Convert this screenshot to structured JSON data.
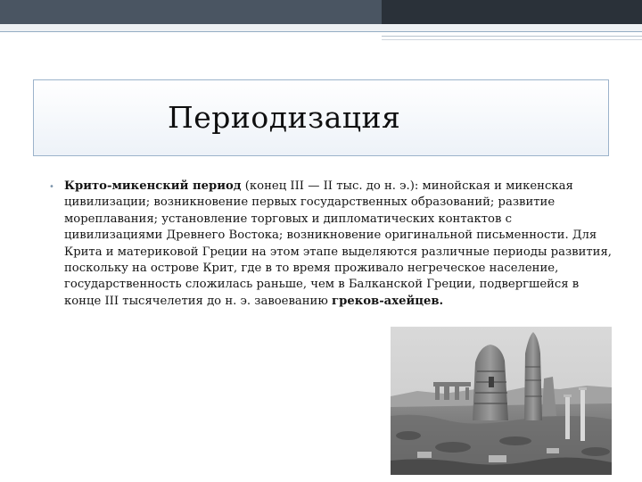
{
  "slide": {
    "title": "Периодизация",
    "paragraph": {
      "term": "Крито-микенский период",
      "text": " (конец III — II тыс. до н. э.): минойская и микенская цивилизации; возникновение первых государственных образований; развитие мореплавания; установление торговых и дипломатических контактов с цивилизациями Древнего Востока; возникновение оригинальной письменности. Для Крита и материковой Греции на этом этапе выделяются различные периоды развития, поскольку на острове Крит, где в то время проживало негреческое население, государственность сложилась раньше, чем в Балканской Греции, подвергшейся в конце III тысячелетия до н. э. завоеванию ",
      "ending": "греков-ахейцев."
    }
  },
  "colors": {
    "header_dark": "#2a3139",
    "header_mid": "#4a5562",
    "title_border": "#9cb3cb",
    "bullet": "#7d95ac"
  },
  "photo": {
    "subject": "ancient-ruins-photo"
  }
}
